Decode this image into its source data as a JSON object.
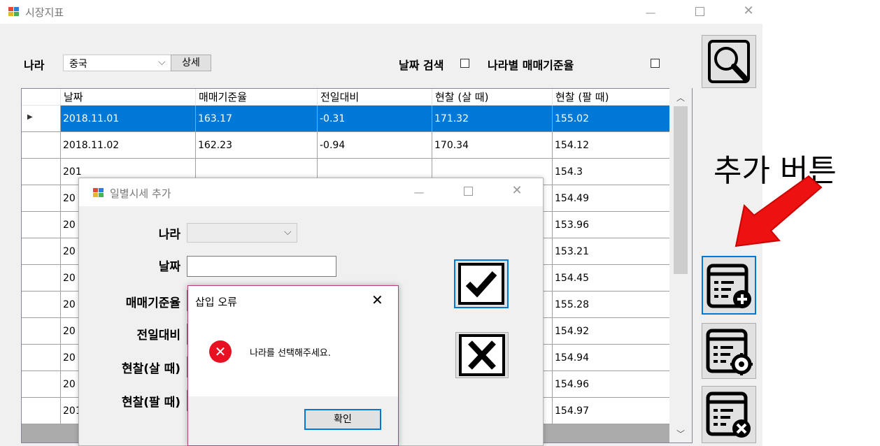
{
  "window": {
    "title": "시장지표"
  },
  "filter": {
    "country_label": "나라",
    "country_value": "중국",
    "detail_button": "상세",
    "date_search_label": "날짜 검색",
    "country_rate_label": "나라별 매매기준율"
  },
  "grid": {
    "columns": [
      "날짜",
      "매매기준율",
      "전일대비",
      "현찰 (살 때)",
      "현찰 (팔 때)"
    ],
    "rows": [
      [
        "2018.11.01",
        "163.17",
        "-0.31",
        "171.32",
        "155.02"
      ],
      [
        "2018.11.02",
        "162.23",
        "-0.94",
        "170.34",
        "154.12"
      ],
      [
        "201",
        "",
        "",
        "",
        "154.3"
      ],
      [
        "20",
        "",
        "",
        "",
        "154.49"
      ],
      [
        "20",
        "",
        "",
        "",
        "153.96"
      ],
      [
        "20",
        "",
        "",
        "",
        "153.21"
      ],
      [
        "20",
        "",
        "",
        "",
        "154.45"
      ],
      [
        "20",
        "",
        "",
        "",
        "155.28"
      ],
      [
        "20",
        "",
        "",
        "",
        "154.92"
      ],
      [
        "20",
        "",
        "",
        "",
        "154.94"
      ],
      [
        "20",
        "",
        "",
        "",
        "154.96"
      ],
      [
        "201",
        "",
        "",
        "",
        "154.97"
      ]
    ]
  },
  "annotation": {
    "text": "추가 버튼",
    "arrow_color": "#ee1111"
  },
  "dialog": {
    "title": "일별시세 추가",
    "fields": {
      "country": "나라",
      "date": "날짜",
      "rate": "매매기준율",
      "change": "전일대비",
      "cash_buy": "현찰(살 때)",
      "cash_sell": "현찰(팔 때)"
    }
  },
  "message_box": {
    "title": "삽입 오류",
    "message": "나라를 선택해주세요.",
    "ok_button": "확인"
  },
  "colors": {
    "selection": "#0078d7",
    "accent_border": "#0078d7",
    "error": "#e81123"
  }
}
